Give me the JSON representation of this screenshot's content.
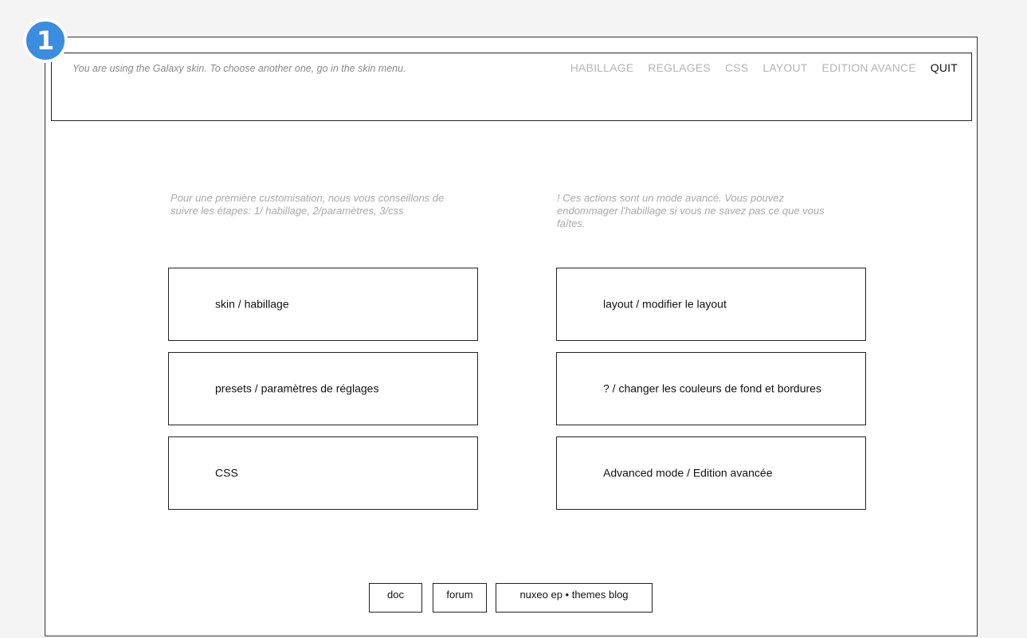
{
  "step_badge": "1",
  "header": {
    "skin_info": "You are using the Galaxy skin. To choose another one, go in the skin menu.",
    "nav": [
      {
        "label": "HABILLAGE",
        "active": false
      },
      {
        "label": "REGLAGES",
        "active": false
      },
      {
        "label": "CSS",
        "active": false
      },
      {
        "label": "LAYOUT",
        "active": false
      },
      {
        "label": "EDITION AVANCE",
        "active": false
      },
      {
        "label": "QUIT",
        "active": true
      }
    ]
  },
  "left_column": {
    "intro": "Pour une première customisation, nous vous conseillons de suivre les étapes: 1/ habillage, 2/paramètres, 3/css",
    "buttons": [
      {
        "label": "skin / habillage"
      },
      {
        "label": "presets / paramètres de réglages"
      },
      {
        "label": "CSS"
      }
    ]
  },
  "right_column": {
    "intro": "! Ces actions sont un mode avancé. Vous pouvez endommager l'habillage si vous ne savez pas ce que vous faîtes.",
    "buttons": [
      {
        "label": "layout / modifier le layout"
      },
      {
        "label": "? / changer les couleurs de fond et bordures"
      },
      {
        "label": "Advanced mode / Edition avancée"
      }
    ]
  },
  "footer": {
    "links": [
      {
        "label": "doc"
      },
      {
        "label": "forum"
      },
      {
        "label": "nuxeo ep • themes blog"
      }
    ]
  },
  "colors": {
    "badge": "#3a8de0",
    "nav_inactive": "#b5b5b5",
    "nav_active": "#111111",
    "muted_text": "#a9a9a9"
  }
}
